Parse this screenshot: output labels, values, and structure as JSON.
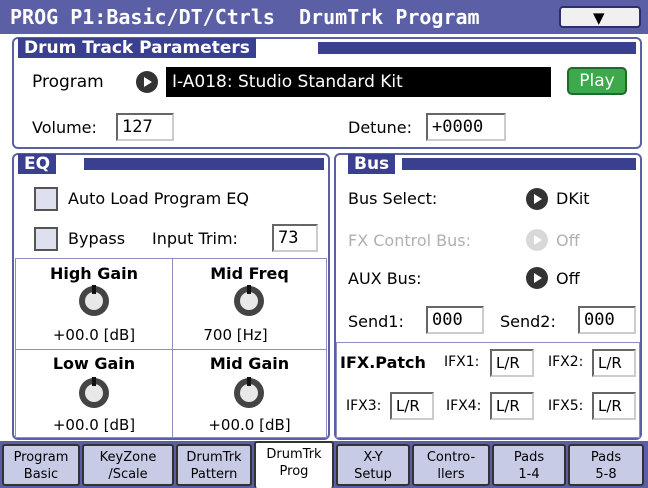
{
  "header": {
    "title": "PROG P1:Basic/DT/Ctrls  DrumTrk Program",
    "menu_icon": "chevron-down-icon"
  },
  "drum_track": {
    "section_title": "Drum Track Parameters",
    "program_label": "Program",
    "program_value": "I-A018: Studio Standard Kit",
    "play_label": "Play",
    "volume_label": "Volume:",
    "volume_value": "127",
    "detune_label": "Detune:",
    "detune_value": "+0000"
  },
  "eq": {
    "section_title": "EQ",
    "auto_load_label": "Auto Load Program EQ",
    "bypass_label": "Bypass",
    "input_trim_label": "Input Trim:",
    "input_trim_value": "73",
    "knobs": [
      {
        "label": "High Gain",
        "value": "+00.0 [dB]"
      },
      {
        "label": "Mid Freq",
        "value": "700 [Hz]"
      },
      {
        "label": "Low Gain",
        "value": "+00.0 [dB]"
      },
      {
        "label": "Mid Gain",
        "value": "+00.0 [dB]"
      }
    ]
  },
  "bus": {
    "section_title": "Bus",
    "bus_select_label": "Bus Select:",
    "bus_select_value": "DKit",
    "fx_control_label": "FX Control Bus:",
    "fx_control_value": "Off",
    "aux_label": "AUX Bus:",
    "aux_value": "Off",
    "send1_label": "Send1:",
    "send1_value": "000",
    "send2_label": "Send2:",
    "send2_value": "000",
    "ifx_patch_label": "IFX.Patch",
    "ifx": [
      {
        "label": "IFX1:",
        "value": "L/R"
      },
      {
        "label": "IFX2:",
        "value": "L/R"
      },
      {
        "label": "IFX3:",
        "value": "L/R"
      },
      {
        "label": "IFX4:",
        "value": "L/R"
      },
      {
        "label": "IFX5:",
        "value": "L/R"
      }
    ]
  },
  "tabs": [
    {
      "line1": "Program",
      "line2": "Basic"
    },
    {
      "line1": "KeyZone",
      "line2": "/Scale"
    },
    {
      "line1": "DrumTrk",
      "line2": "Pattern"
    },
    {
      "line1": "DrumTrk",
      "line2": "Prog"
    },
    {
      "line1": "X-Y",
      "line2": "Setup"
    },
    {
      "line1": "Contro-",
      "line2": "llers"
    },
    {
      "line1": "Pads",
      "line2": "1-4"
    },
    {
      "line1": "Pads",
      "line2": "5-8"
    }
  ],
  "active_tab": 3
}
